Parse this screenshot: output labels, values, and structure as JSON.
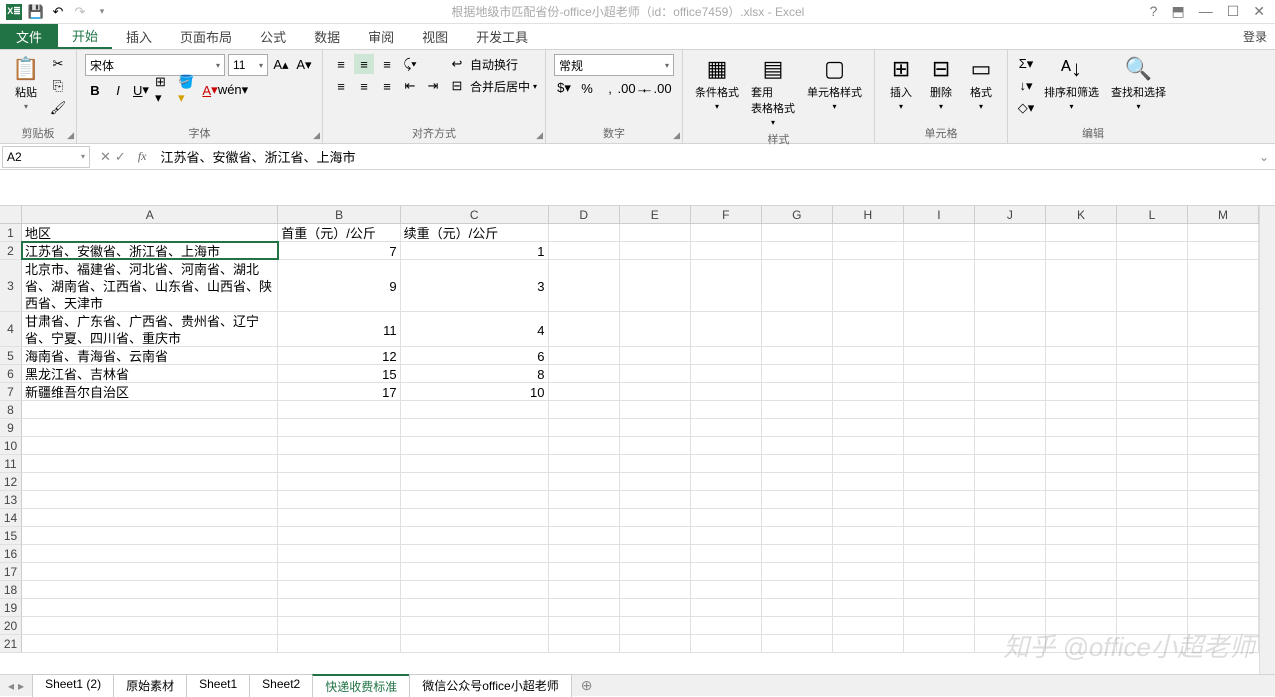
{
  "title": "根据地级市匹配省份-office小超老师（id：office7459）.xlsx - Excel",
  "login": "登录",
  "tabs": {
    "file": "文件",
    "items": [
      "开始",
      "插入",
      "页面布局",
      "公式",
      "数据",
      "审阅",
      "视图",
      "开发工具"
    ],
    "active": 0
  },
  "ribbon": {
    "clipboard": {
      "paste": "粘贴",
      "label": "剪贴板"
    },
    "font": {
      "name": "宋体",
      "size": "11",
      "label": "字体"
    },
    "align": {
      "wrap": "自动换行",
      "merge": "合并后居中",
      "label": "对齐方式"
    },
    "number": {
      "format": "常规",
      "label": "数字"
    },
    "styles": {
      "cond": "条件格式",
      "table": "套用\n表格格式",
      "cell": "单元格样式",
      "label": "样式"
    },
    "cells": {
      "insert": "插入",
      "delete": "删除",
      "format": "格式",
      "label": "单元格"
    },
    "editing": {
      "sort": "排序和筛选",
      "find": "查找和选择",
      "label": "编辑"
    }
  },
  "nameBox": "A2",
  "formula": "江苏省、安徽省、浙江省、上海市",
  "columns": [
    "A",
    "B",
    "C",
    "D",
    "E",
    "F",
    "G",
    "H",
    "I",
    "J",
    "K",
    "L",
    "M"
  ],
  "headers": [
    "地区",
    "首重（元）/公斤",
    "续重（元）/公斤"
  ],
  "rows": [
    {
      "h": 18,
      "a": "江苏省、安徽省、浙江省、上海市",
      "b": "7",
      "c": "1"
    },
    {
      "h": 52,
      "a": "北京市、福建省、河北省、河南省、湖北省、湖南省、江西省、山东省、山西省、陕西省、天津市",
      "b": "9",
      "c": "3"
    },
    {
      "h": 35,
      "a": "甘肃省、广东省、广西省、贵州省、辽宁省、宁夏、四川省、重庆市",
      "b": "11",
      "c": "4"
    },
    {
      "h": 18,
      "a": "海南省、青海省、云南省",
      "b": "12",
      "c": "6"
    },
    {
      "h": 18,
      "a": "黑龙江省、吉林省",
      "b": "15",
      "c": "8"
    },
    {
      "h": 18,
      "a": "新疆维吾尔自治区",
      "b": "17",
      "c": "10"
    }
  ],
  "sheets": [
    "Sheet1 (2)",
    "原始素材",
    "Sheet1",
    "Sheet2",
    "快递收费标准",
    "微信公众号office小超老师"
  ],
  "activeSheet": 4,
  "watermark": "知乎 @office小超老师"
}
